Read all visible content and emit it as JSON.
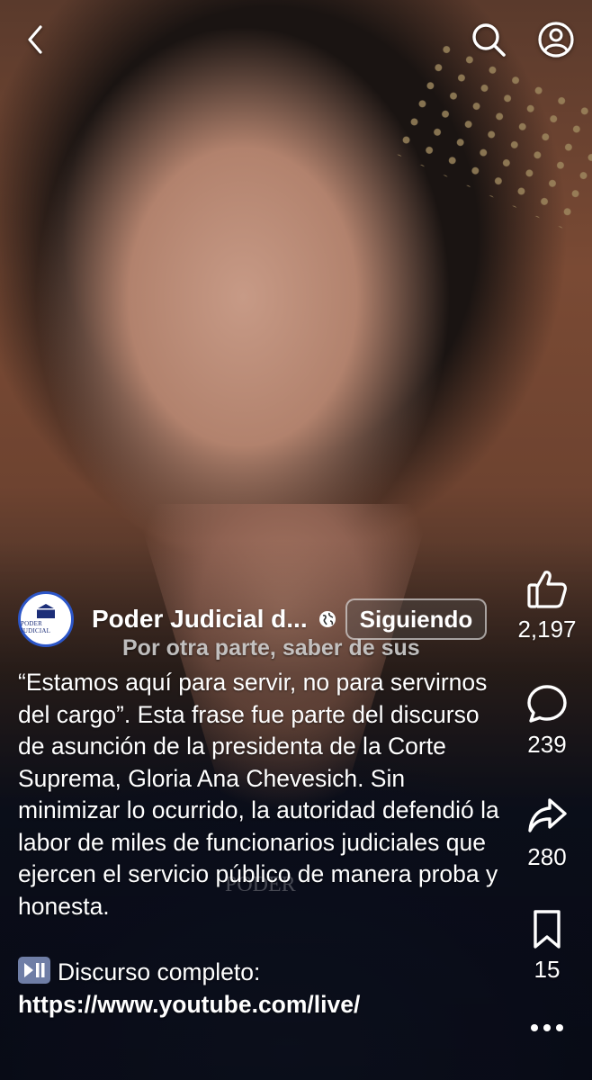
{
  "author": {
    "name": "Poder Judicial d...",
    "avatar_text": "PODER JUDICIAL",
    "follow_label": "Siguiendo"
  },
  "video": {
    "subtitle_text": "Por otra parte, saber de sus",
    "watermark_text": "PODER"
  },
  "caption": {
    "body": "“Estamos aquí para servir, no para servirnos del cargo”. Esta frase fue parte del discurso de asunción de la presidenta de la Corte Suprema, Gloria Ana Chevesich. Sin minimizar lo ocurrido, la autoridad defendió la labor de miles de funcionarios judiciales que ejercen el servicio público de manera proba y honesta.",
    "link_prefix": "Discurso completo: ",
    "link_url": "https://www.youtube.com/live/"
  },
  "actions": {
    "likes": "2,197",
    "comments": "239",
    "shares": "280",
    "saves": "15"
  },
  "icons": {
    "back": "chevron-left-icon",
    "search": "search-icon",
    "profile": "user-circle-icon",
    "like": "thumbs-up-icon",
    "comment": "comment-bubble-icon",
    "share": "share-arrow-icon",
    "save": "bookmark-icon",
    "more": "more-dots-icon",
    "verified": "globe-icon",
    "play_pause": "play-pause-icon"
  },
  "colors": {
    "avatar_ring": "#2c56c8",
    "play_pause_badge": "#6f7ea6"
  }
}
